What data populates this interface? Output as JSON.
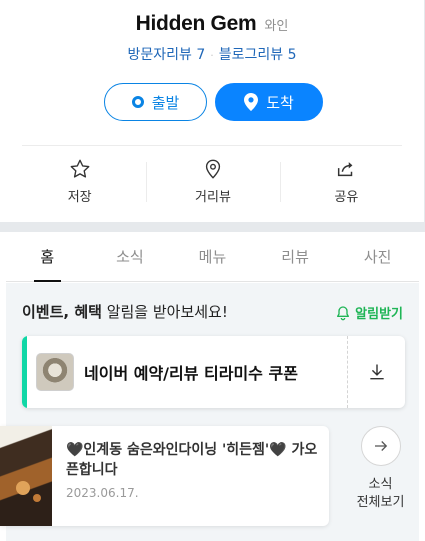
{
  "place": {
    "name": "Hidden Gem",
    "category": "와인",
    "visitor_review_label": "방문자리뷰",
    "visitor_review_count": "7",
    "blog_review_label": "블로그리뷰",
    "blog_review_count": "5"
  },
  "route": {
    "depart_label": "출발",
    "arrive_label": "도착"
  },
  "actions": {
    "save": "저장",
    "street_view": "거리뷰",
    "share": "공유"
  },
  "tabs": [
    "홈",
    "소식",
    "메뉴",
    "리뷰",
    "사진"
  ],
  "active_tab": "홈",
  "notice": {
    "bold_part": "이벤트, 혜택",
    "rest": " 알림을 받아보세요!",
    "alarm_label": "알림받기"
  },
  "coupon": {
    "text": "네이버 예약/리뷰 티라미수 쿠폰"
  },
  "news": {
    "title": "🖤인계동 숨은와인다이닝 '히든젬'🖤 가오픈합니다",
    "date": "2023.06.17."
  },
  "more_news": {
    "line1": "소식",
    "line2": "전체보기"
  },
  "colors": {
    "brand_blue": "#0a84ff",
    "review_link": "#1f67b8",
    "alarm_green": "#1fb556",
    "coupon_accent": "#10d7a6"
  }
}
